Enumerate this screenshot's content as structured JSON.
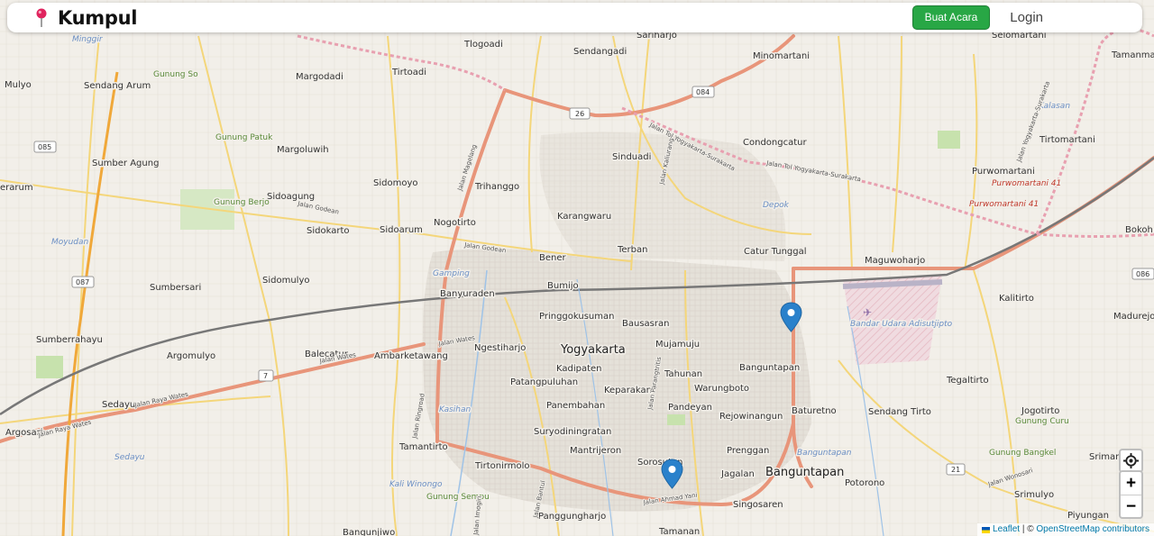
{
  "brand": {
    "name": "Kumpul",
    "icon": "map-pin-icon"
  },
  "nav": {
    "create_label": "Buat Acara",
    "login_label": "Login"
  },
  "map": {
    "labels": {
      "yogyakarta": "Yogyakarta",
      "sedayu": "Sedayu",
      "banguntapan": "Banguntapan",
      "minggir": "Minggir",
      "tlogoadi": "Tlogoadi",
      "sariharjo": "Sariharjo",
      "sendangadi": "Sendangadi",
      "minomartani": "Minomartani",
      "selomartani": "Selomartani",
      "tamanmartani": "Tamanmartani",
      "mulyo": "Mulyo",
      "sendang_arum": "Sendang Arum",
      "gunung_so": "Gunung So",
      "margodadi": "Margodadi",
      "tirtoadi": "Tirtoadi",
      "sumber_agung": "Sumber Agung",
      "gunung_patuk": "Gunung Patuk",
      "margoluwih": "Margoluwih",
      "sinduadi": "Sinduadi",
      "condongcatur": "Condongcatur",
      "tirtomartani": "Tirtomartani",
      "purwomartani": "Purwomartani",
      "purwomartani_41a": "Purwomartani 41",
      "purwomartani_41b": "Purwomartani 41",
      "kalasan": "Kalasan",
      "bokoharjo": "Bokoh",
      "ngerarum": "erarum",
      "sidomoyo": "Sidomoyo",
      "trihanggo": "Trihanggo",
      "sidoagung": "Sidoagung",
      "gunung_berjo": "Gunung Berjo",
      "nogotirto": "Nogotirto",
      "karangwaru": "Karangwaru",
      "depok": "Depok",
      "sidokarto": "Sidokarto",
      "sidoarum": "Sidoarum",
      "terban": "Terban",
      "catur_tunggal": "Catur Tunggal",
      "maguwoharjo": "Maguwoharjo",
      "moyudan": "Moyudan",
      "gamping": "Gamping",
      "bener": "Bener",
      "bumijo": "Bumijo",
      "sumbersari": "Sumbersari",
      "sidomulyo": "Sidomulyo",
      "banyuraden": "Banyuraden",
      "kalitirto": "Kalitirto",
      "pringgokusuman": "Pringgokusuman",
      "bausasran": "Bausasran",
      "bandar_udara": "Bandar Udara Adisutjipto",
      "madurejo": "Madurejo",
      "sumberrahayu": "Sumberrahayu",
      "ngestiharjo": "Ngestiharjo",
      "mujamuju": "Mujamuju",
      "argomulyo": "Argomulyo",
      "balecatur": "Balecatur",
      "ambarketawang": "Ambarketawang",
      "kadipaten": "Kadipaten",
      "tahunan": "Tahunan",
      "banguntapan_small": "Banguntapan",
      "tegaltirto": "Tegaltirto",
      "patangpuluhan": "Patangpuluhan",
      "keparakan": "Keparakan",
      "warungboto": "Warungboto",
      "panembahan": "Panembahan",
      "pandeyan": "Pandeyan",
      "rejowinangun": "Rejowinangun",
      "baturetno": "Baturetno",
      "sendang_tirto": "Sendang Tirto",
      "jogotirto": "Jogotirto",
      "argosari": "Argosari",
      "kasihan": "Kasihan",
      "suryodiningratan": "Suryodiningratan",
      "prenggan": "Prenggan",
      "gunung_curu": "Gunung Curu",
      "tamantirto": "Tamantirto",
      "mantrijeron": "Mantrijeron",
      "sorosutan": "Sorosutan",
      "banguntapan_italic": "Banguntapan",
      "gunung_bangkel": "Gunung Bangkel",
      "srimartani": "Srimartan",
      "sedayu_italic": "Sedayu",
      "tirtonirmolo": "Tirtonirmolo",
      "jagalan": "Jagalan",
      "potorono": "Potorono",
      "srimulyo": "Srimulyo",
      "gunung_sempu": "Gunung Sempu",
      "kali_winongo": "Kali Winongo",
      "panggungharjo": "Panggungharjo",
      "singosaren": "Singosaren",
      "piyungan": "Piyungan",
      "tamanan": "Tamanan",
      "bangunjiwo": "Bangunjiwo"
    },
    "road_labels": {
      "jalan_godean": "Jalan Godean",
      "jalan_wates": "Jalan Wates",
      "jalan_raya_wates": "Jalan Raya Wates",
      "jalan_ahmad_yani": "Jalan Ahmad Yani",
      "jalan_magelang": "Jalan Magelang",
      "jalan_kaliurang": "Jalan Kaliurang",
      "jalan_tol_yogyakarta_surakarta": "Jalan Tol Yogyakarta-Surakarta",
      "jalan_solo": "Jalan Yogyakarta-Surakarta",
      "jalan_bantul": "Jalan Bantul",
      "jalan_imogiri": "Jalan Imogiri",
      "jalan_wonosari": "Jalan Wonosari",
      "jalan_parangtritis": "Jalan Parangtritis",
      "jalan_ringroad": "Jalan Ringroad"
    },
    "shields": {
      "r26": "26",
      "r084": "084",
      "r085": "085",
      "r087": "087",
      "r086": "086",
      "r7": "7",
      "r21": "21"
    },
    "markers": [
      "blue-map-marker",
      "blue-map-marker"
    ]
  },
  "controls": {
    "zoom_in": "+",
    "zoom_out": "−",
    "locate_icon": "crosshair-icon"
  },
  "attribution": {
    "leaflet": "Leaflet",
    "separator": " | © ",
    "osm": "OpenStreetMap contributors"
  },
  "colors": {
    "primary": "#28a745",
    "brand_pin": "#e0245e",
    "marker": "#2a81cb",
    "road_major": "#e8957a",
    "road_secondary": "#f4d67a"
  }
}
